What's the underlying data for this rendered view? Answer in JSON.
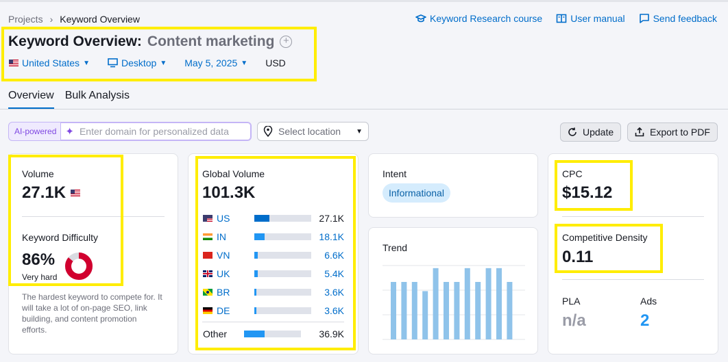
{
  "breadcrumb": {
    "root": "Projects",
    "current": "Keyword Overview"
  },
  "header_links": {
    "course": "Keyword Research course",
    "manual": "User manual",
    "feedback": "Send feedback"
  },
  "title": {
    "prefix": "Keyword Overview:",
    "keyword": "Content marketing"
  },
  "filters": {
    "country": "United States",
    "device": "Desktop",
    "date": "May 5, 2025",
    "currency": "USD"
  },
  "tabs": [
    "Overview",
    "Bulk Analysis"
  ],
  "toolbar": {
    "ai_tag": "AI-powered",
    "domain_placeholder": "Enter domain for personalized data",
    "location_placeholder": "Select location",
    "update": "Update",
    "export": "Export to PDF"
  },
  "volume": {
    "label": "Volume",
    "value": "27.1K"
  },
  "kd": {
    "label": "Keyword Difficulty",
    "value": "86%",
    "percent": 86,
    "level": "Very hard",
    "description": "The hardest keyword to compete for. It will take a lot of on-page SEO, link building, and content promotion efforts."
  },
  "global_volume": {
    "label": "Global Volume",
    "value": "101.3K",
    "rows": [
      {
        "code": "US",
        "value": "27.1K",
        "share": 0.27,
        "link": false
      },
      {
        "code": "IN",
        "value": "18.1K",
        "share": 0.18,
        "link": true
      },
      {
        "code": "VN",
        "value": "6.6K",
        "share": 0.065,
        "link": true
      },
      {
        "code": "UK",
        "value": "5.4K",
        "share": 0.055,
        "link": true
      },
      {
        "code": "BR",
        "value": "3.6K",
        "share": 0.036,
        "link": true
      },
      {
        "code": "DE",
        "value": "3.6K",
        "share": 0.036,
        "link": true
      }
    ],
    "other": {
      "label": "Other",
      "value": "36.9K",
      "share": 0.365
    }
  },
  "intent": {
    "label": "Intent",
    "value": "Informational"
  },
  "trend": {
    "label": "Trend",
    "values": [
      0.75,
      0.75,
      0.75,
      0.63,
      0.93,
      0.75,
      0.75,
      0.93,
      0.75,
      0.93,
      0.93,
      0.75
    ]
  },
  "cpc": {
    "label": "CPC",
    "value": "$15.12"
  },
  "competitive_density": {
    "label": "Competitive Density",
    "value": "0.11"
  },
  "pla": {
    "label": "PLA",
    "value": "n/a"
  },
  "ads": {
    "label": "Ads",
    "value": "2"
  },
  "colors": {
    "accent": "#006dca",
    "kd_red": "#d1002f",
    "bar_blue": "#2196f3",
    "trend_bar": "#8fc3ea",
    "highlight": "#ffed00"
  }
}
